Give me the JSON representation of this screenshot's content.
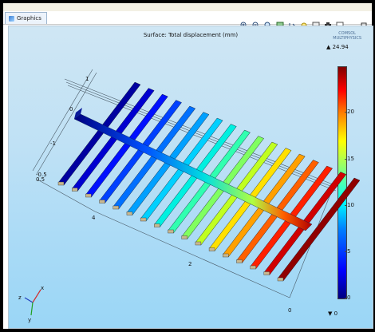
{
  "tab": {
    "label": "Graphics",
    "icon": "graphics-icon"
  },
  "toolbar": {
    "icons": [
      "zoom-in-icon",
      "zoom-out-icon",
      "zoom-box-icon",
      "zoom-extents-icon",
      "view-menu-icon",
      "scene-light-icon",
      "transparency-icon",
      "image-snapshot-icon",
      "print-icon",
      "minimize-icon",
      "maximize-icon"
    ]
  },
  "plot": {
    "title": "Surface: Total displacement (mm)",
    "logo_line1": "COMSOL",
    "logo_line2": "MULTIPHYSICS",
    "max_label": "▲ 24.94",
    "min_label": "▼ 0"
  },
  "colorbar": {
    "ticks": [
      "20",
      "15",
      "10",
      "5",
      "0"
    ],
    "tick_values": [
      20,
      15,
      10,
      5,
      0
    ],
    "range": [
      0,
      24.94
    ]
  },
  "axes": {
    "labels": [
      "1",
      "0",
      "-1",
      "-0.5",
      "0.5",
      "4",
      "2",
      "0"
    ]
  },
  "triad": {
    "x": "x",
    "y": "y",
    "z": "z"
  },
  "colors": {
    "viewport_top": "#cfe6f4",
    "viewport_bottom": "#9ad6f6",
    "accent": "#3b7fd4"
  }
}
